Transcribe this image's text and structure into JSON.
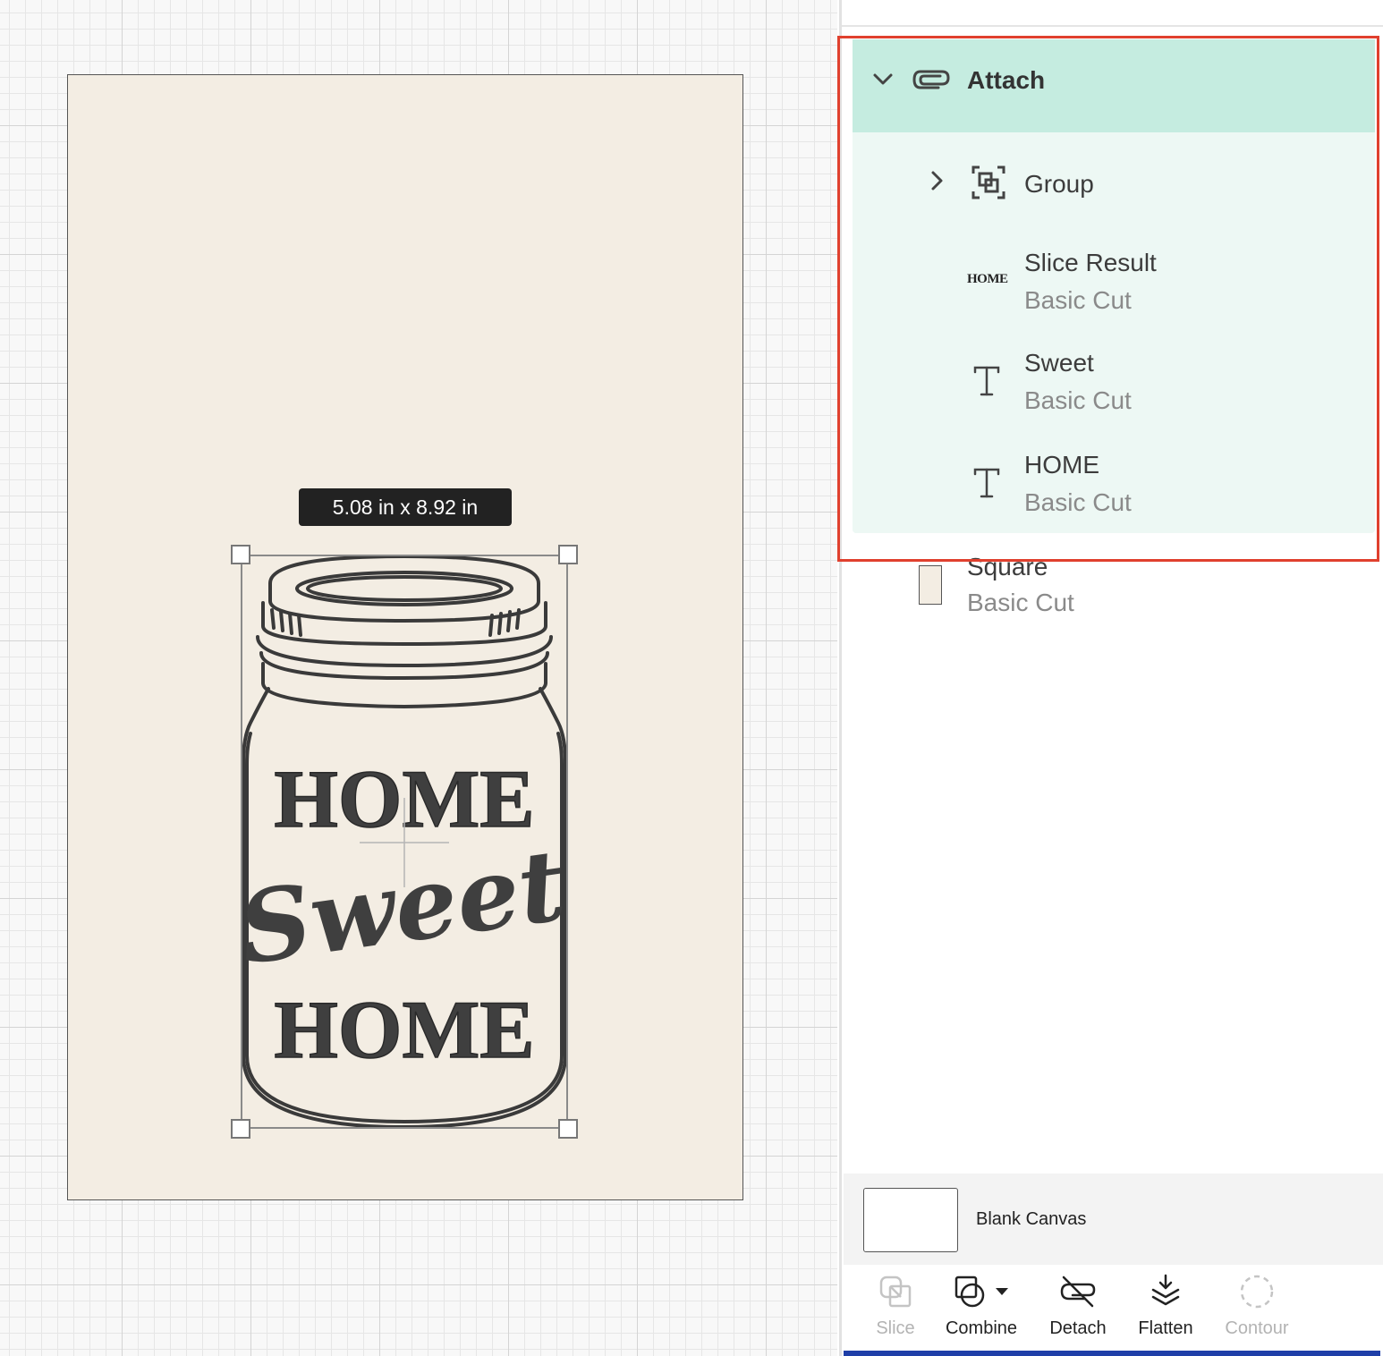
{
  "canvas": {
    "dimension_tooltip": "5.08  in x 8.92  in",
    "design_text": {
      "line1": "HOME",
      "line2": "Sweet",
      "line3": "HOME"
    }
  },
  "layers": {
    "attach": {
      "label": "Attach",
      "expanded": true
    },
    "children": [
      {
        "label": "Group",
        "sub": "",
        "icon": "group-icon",
        "collapsed": true
      },
      {
        "label": "Slice Result",
        "sub": "Basic Cut",
        "thumb_text": "HOME"
      },
      {
        "label": "Sweet",
        "sub": "Basic Cut",
        "icon": "text-icon"
      },
      {
        "label": "HOME",
        "sub": "Basic Cut",
        "icon": "text-icon"
      }
    ],
    "square": {
      "label": "Square",
      "sub": "Basic Cut"
    }
  },
  "blank_canvas": {
    "label": "Blank Canvas"
  },
  "toolbar": {
    "slice": "Slice",
    "combine": "Combine",
    "detach": "Detach",
    "flatten": "Flatten",
    "contour": "Contour"
  },
  "colors": {
    "attach_header": "#c5ece0",
    "attach_group_bg": "#edf8f4",
    "highlight": "#e0402e",
    "mat": "#f3ede3"
  }
}
